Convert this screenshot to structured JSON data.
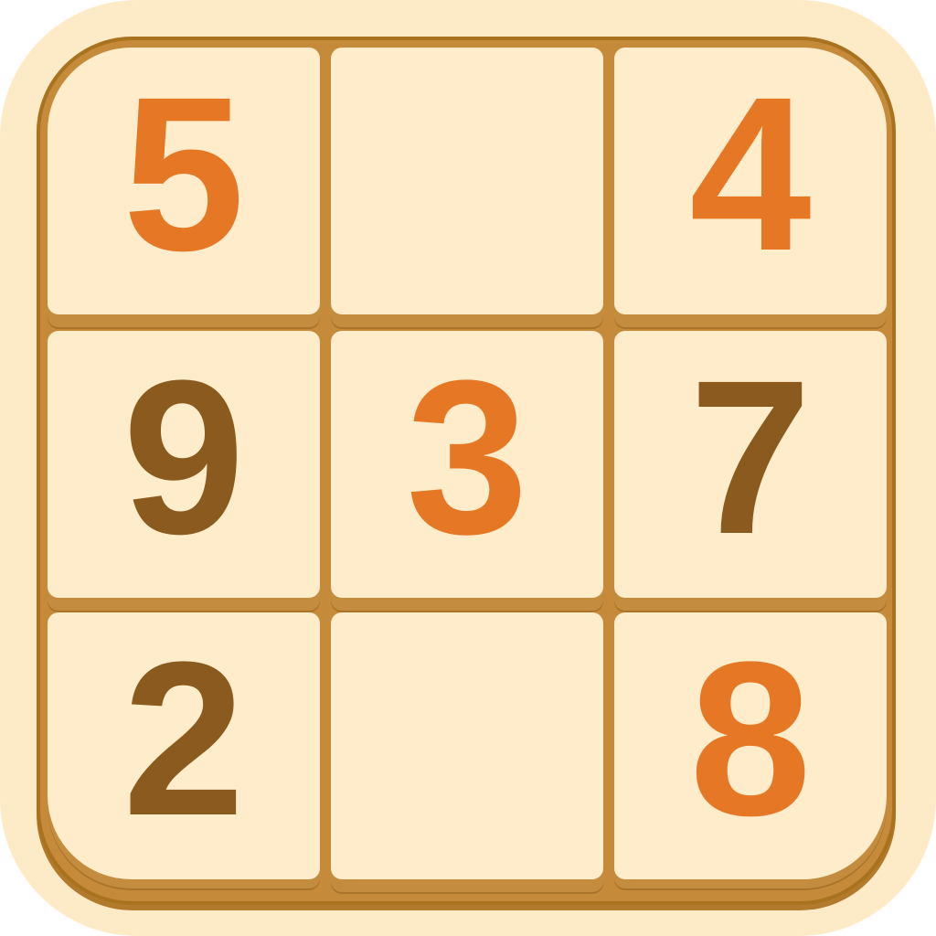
{
  "colors": {
    "given": "#8b5a1f",
    "entered": "#e67825",
    "tile": "#ffeccb",
    "board": "#c58a3a",
    "background": "#fdebc7"
  },
  "grid": {
    "cells": [
      {
        "value": "5",
        "kind": "entered"
      },
      {
        "value": "",
        "kind": "empty"
      },
      {
        "value": "4",
        "kind": "entered"
      },
      {
        "value": "9",
        "kind": "given"
      },
      {
        "value": "3",
        "kind": "entered"
      },
      {
        "value": "7",
        "kind": "given"
      },
      {
        "value": "2",
        "kind": "given"
      },
      {
        "value": "",
        "kind": "empty"
      },
      {
        "value": "8",
        "kind": "entered"
      }
    ]
  }
}
